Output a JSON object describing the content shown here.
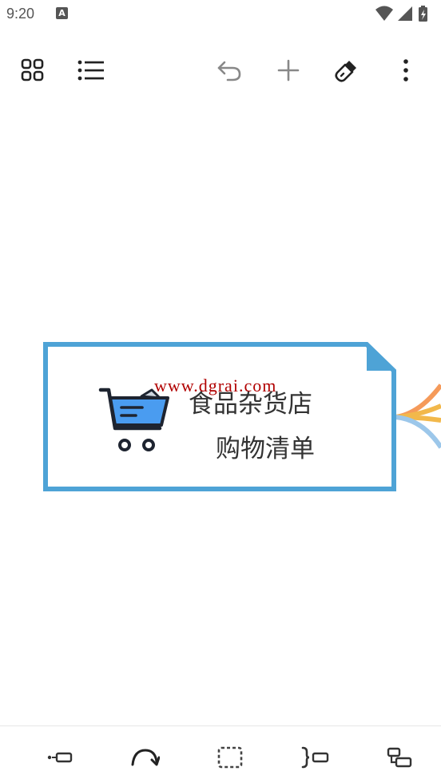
{
  "status_bar": {
    "time": "9:20",
    "notification_icon": "A"
  },
  "toolbar": {
    "icons": [
      "grid-icon",
      "outline-list-icon",
      "undo-icon",
      "add-icon",
      "style-brush-icon",
      "more-icon"
    ]
  },
  "node": {
    "title_line1": "食品杂货店",
    "title_line2": "购物清单",
    "watermark": "www.dgrai.com",
    "border_color": "#4ea3d6",
    "cart_color": "#4a9cf0"
  },
  "bottom_toolbar": {
    "icons": [
      "insert-topic-icon",
      "relationship-icon",
      "boundary-icon",
      "summary-icon",
      "subtopic-icon"
    ]
  },
  "colors": {
    "branch_orange": "#f59a5a",
    "branch_yellow": "#f2b84b",
    "branch_blue": "#9cc7ea"
  }
}
